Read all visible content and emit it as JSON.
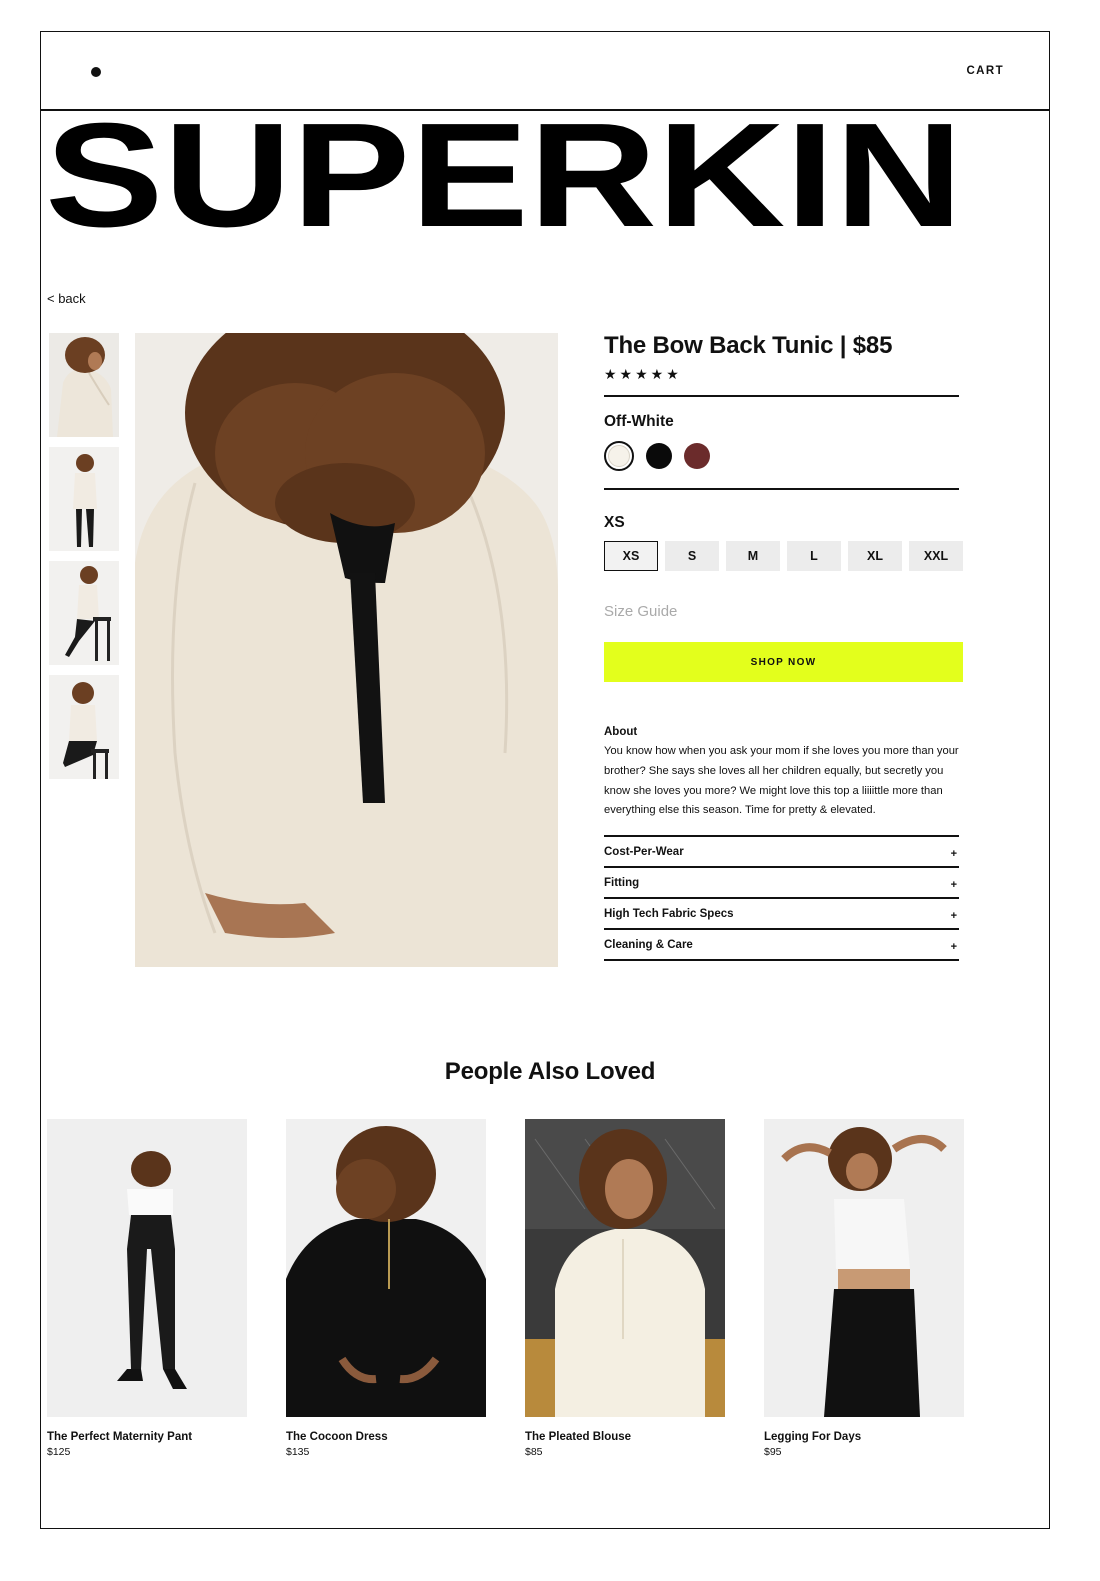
{
  "header": {
    "cart_label": "CART",
    "menu_icon": "menu-dot-icon"
  },
  "brand": {
    "wordmark": "SUPERKIN"
  },
  "nav": {
    "back_label": "< back"
  },
  "gallery": {
    "thumbnails": [
      "thumbnail-1",
      "thumbnail-2",
      "thumbnail-3",
      "thumbnail-4"
    ]
  },
  "product": {
    "title": "The Bow Back Tunic | $85",
    "rating_stars": "★★★★★",
    "color": {
      "selected_label": "Off-White",
      "swatches": [
        "#f6f2ea",
        "#0a0a0a",
        "#6b2b2b"
      ]
    },
    "size": {
      "selected_label": "XS",
      "options": [
        "XS",
        "S",
        "M",
        "L",
        "XL",
        "XXL"
      ]
    },
    "size_guide_label": "Size Guide",
    "cta_label": "SHOP NOW",
    "cta_color": "#e3ff1c",
    "about": {
      "heading": "About",
      "text": "You know how when you ask your mom if she loves you more than your brother? She says she loves all her children equally, but secretly you know she loves you more? We might love this top a liiiittle more than everything else this season. Time for pretty & elevated."
    },
    "accordion": [
      {
        "label": "Cost-Per-Wear",
        "icon": "+"
      },
      {
        "label": "Fitting",
        "icon": "+"
      },
      {
        "label": "High Tech Fabric Specs",
        "icon": "+"
      },
      {
        "label": "Cleaning & Care",
        "icon": "+"
      }
    ]
  },
  "related": {
    "title": "People Also Loved",
    "items": [
      {
        "name": "The Perfect Maternity Pant",
        "price": "$125"
      },
      {
        "name": "The Cocoon Dress",
        "price": "$135"
      },
      {
        "name": "The Pleated Blouse",
        "price": "$85"
      },
      {
        "name": "Legging For Days",
        "price": "$95"
      }
    ]
  }
}
